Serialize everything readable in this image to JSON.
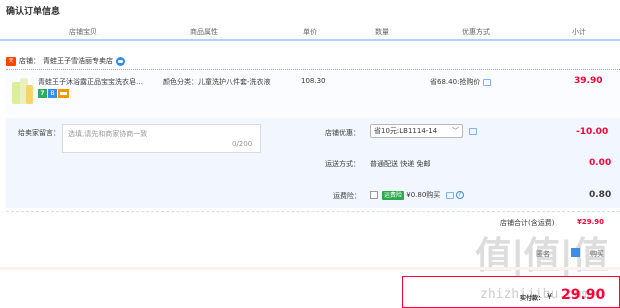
{
  "page_title": "确认订单信息",
  "table_headers": [
    "店铺宝贝",
    "商品属性",
    "单价",
    "数量",
    "优惠方式",
    "小计"
  ],
  "shop": {
    "label": "店铺：",
    "name": "青蛙王子雪浩丽专卖店",
    "badge": "tmall"
  },
  "item": {
    "title": "青蛙王子沐浴露正品宝宝洗衣皂…",
    "attribute": "颜色分类：儿童洗护八件套-洗衣液",
    "price": "108.30",
    "promo": "省68.40:抢购价",
    "subtotal": "39.90",
    "tags": [
      "7",
      "B"
    ]
  },
  "message": {
    "label": "给卖家留言：",
    "placeholder": "选填,请先和商家协商一致",
    "count": "0/200"
  },
  "shop_discount": {
    "label": "店铺优惠：",
    "selected": "省10元:LB1114-14",
    "value": "-10.00"
  },
  "shipping": {
    "label": "运送方式：",
    "method": "普通配送 快递 免邮",
    "value": "0.00"
  },
  "insurance": {
    "label": "运费险：",
    "tag": "运费险",
    "desc": "¥0.80购买",
    "value": "0.80"
  },
  "shop_total": {
    "label": "店铺合计(含运费)",
    "value": "¥29.90"
  },
  "anonymous": {
    "label": "匿名",
    "text": "购买"
  },
  "payment": {
    "label": "实付款：",
    "currency": "¥",
    "value": "29.90"
  },
  "watermark": {
    "big": "值|值|值",
    "site": "zhizhijibu.com"
  },
  "colors": {
    "accent_red": "#ff0036",
    "header_line": "#b2d1ff",
    "link_blue": "#3b8de6",
    "tmall_red": "#ff4400"
  }
}
